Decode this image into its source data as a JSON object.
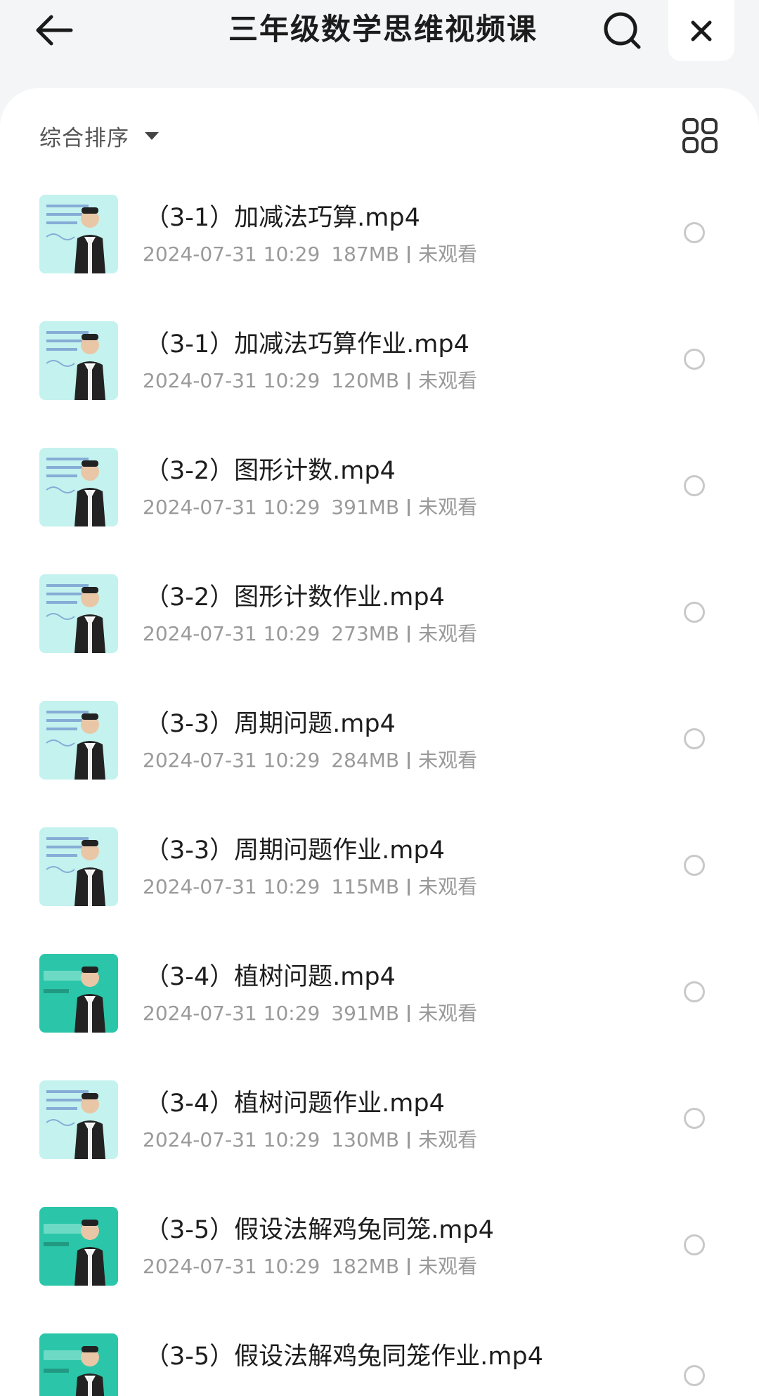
{
  "header": {
    "title": "三年级数学思维视频课",
    "back_icon": "arrow-left-icon",
    "search_icon": "search-icon",
    "close_icon": "close-icon"
  },
  "toolbar": {
    "sort_label": "综合排序",
    "grid_icon": "grid-view-icon"
  },
  "colors": {
    "background": "#f4f5f7",
    "card": "#ffffff",
    "meta_text": "#9a9a9a",
    "thumb_cyan": "#bff0ee",
    "thumb_green": "#29c7a8"
  },
  "files": [
    {
      "title": "（3-1）加减法巧算.mp4",
      "date": "2024-07-31 10:29",
      "size": "187MB",
      "status": "未观看",
      "thumb": "cyan"
    },
    {
      "title": "（3-1）加减法巧算作业.mp4",
      "date": "2024-07-31 10:29",
      "size": "120MB",
      "status": "未观看",
      "thumb": "cyan"
    },
    {
      "title": "（3-2）图形计数.mp4",
      "date": "2024-07-31 10:29",
      "size": "391MB",
      "status": "未观看",
      "thumb": "cyan"
    },
    {
      "title": "（3-2）图形计数作业.mp4",
      "date": "2024-07-31 10:29",
      "size": "273MB",
      "status": "未观看",
      "thumb": "cyan"
    },
    {
      "title": "（3-3）周期问题.mp4",
      "date": "2024-07-31 10:29",
      "size": "284MB",
      "status": "未观看",
      "thumb": "cyan"
    },
    {
      "title": "（3-3）周期问题作业.mp4",
      "date": "2024-07-31 10:29",
      "size": "115MB",
      "status": "未观看",
      "thumb": "cyan"
    },
    {
      "title": "（3-4）植树问题.mp4",
      "date": "2024-07-31 10:29",
      "size": "391MB",
      "status": "未观看",
      "thumb": "green"
    },
    {
      "title": "（3-4）植树问题作业.mp4",
      "date": "2024-07-31 10:29",
      "size": "130MB",
      "status": "未观看",
      "thumb": "cyan"
    },
    {
      "title": "（3-5）假设法解鸡兔同笼.mp4",
      "date": "2024-07-31 10:29",
      "size": "182MB",
      "status": "未观看",
      "thumb": "green"
    },
    {
      "title": "（3-5）假设法解鸡兔同笼作业.mp4",
      "date": "",
      "size": "",
      "status": "",
      "thumb": "green"
    }
  ]
}
